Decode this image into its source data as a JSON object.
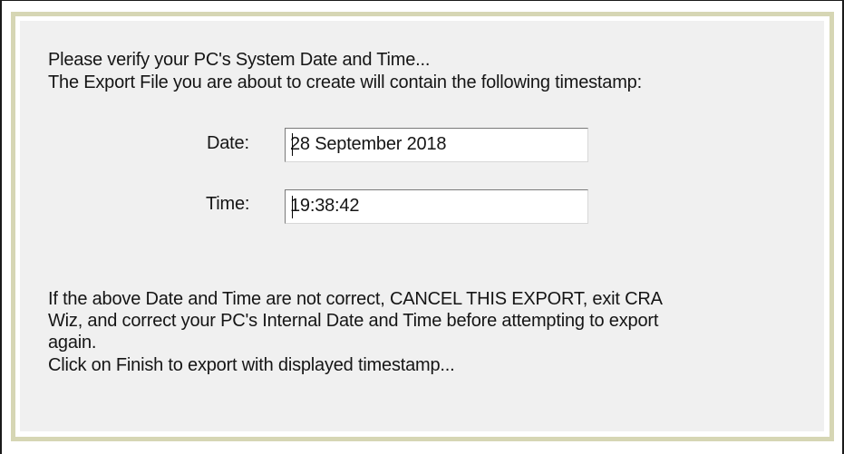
{
  "dialog": {
    "intro": {
      "line1": "Please verify your PC's System Date and Time...",
      "line2": "The Export File you are about to create will contain the following timestamp:"
    },
    "date": {
      "label": "Date:",
      "value": "28 September 2018"
    },
    "time": {
      "label": "Time:",
      "value": "19:38:42"
    },
    "warning": {
      "line1": "If the above Date and Time are not correct, CANCEL THIS EXPORT, exit CRA",
      "line2": "Wiz, and correct your PC's Internal Date and Time before attempting to export",
      "line3": "again.",
      "line4": "Click on Finish to export with displayed timestamp..."
    }
  },
  "colors": {
    "panel_background": "#f0f0f0",
    "panel_border": "#d6d6b4",
    "text": "#151515"
  }
}
